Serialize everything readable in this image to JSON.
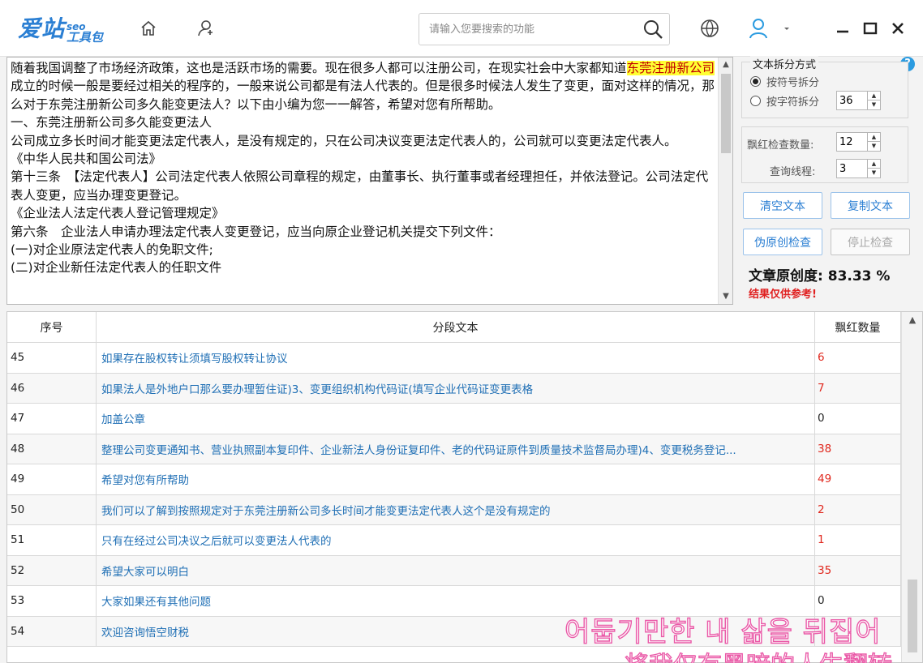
{
  "app": {
    "logo_main": "爱站",
    "logo_seo": "seo",
    "logo_tool": "工具包"
  },
  "search": {
    "placeholder": "请输入您要搜索的功能"
  },
  "editor": {
    "text_before": "随着我国调整了市场经济政策，这也是活跃市场的需要。现在很多人都可以注册公司，在现实社会中大家都知道",
    "highlight": "东莞注册新公司",
    "text_after": "成立的时候一般是要经过相关的程序的，一般来说公司都是有法人代表的。但是很多时候法人发生了变更，面对这样的情况，那么对于东莞注册新公司多久能变更法人？以下由小编为您一一解答，希望对您有所帮助。\n一、东莞注册新公司多久能变更法人\n公司成立多长时间才能变更法定代表人，是没有规定的，只在公司决议变更法定代表人的，公司就可以变更法定代表人。\n《中华人民共和国公司法》\n第十三条　【法定代表人】公司法定代表人依照公司章程的规定，由董事长、执行董事或者经理担任，并依法登记。公司法定代表人变更，应当办理变更登记。\n《企业法人法定代表人登记管理规定》\n第六条　企业法人申请办理法定代表人变更登记，应当向原企业登记机关提交下列文件：\n(一)对企业原法定代表人的免职文件;\n(二)对企业新任法定代表人的任职文件"
  },
  "panel": {
    "split_title": "文本拆分方式",
    "split_by_symbol": "按符号拆分",
    "split_by_chars": "按字符拆分",
    "chars_value": "36",
    "red_check_label": "飘红检查数量:",
    "red_check_value": "12",
    "threads_label": "查询线程:",
    "threads_value": "3",
    "clear_btn": "清空文本",
    "copy_btn": "复制文本",
    "check_btn": "伪原创检查",
    "stop_btn": "停止检查",
    "score_label": "文章原创度:",
    "score_value": "83.33 %",
    "note": "结果仅供参考!"
  },
  "table": {
    "headers": [
      "序号",
      "分段文本",
      "飘红数量"
    ],
    "rows": [
      {
        "no": "45",
        "text": "如果存在股权转让须填写股权转让协议",
        "count": "6",
        "red": true
      },
      {
        "no": "46",
        "text": "如果法人是外地户口那么要办理暂住证)3、变更组织机构代码证(填写企业代码证变更表格",
        "count": "7",
        "red": true
      },
      {
        "no": "47",
        "text": "加盖公章",
        "count": "0",
        "red": false
      },
      {
        "no": "48",
        "text": "整理公司变更通知书、营业执照副本复印件、企业新法人身份证复印件、老的代码证原件到质量技术监督局办理)4、变更税务登记...",
        "count": "38",
        "red": true
      },
      {
        "no": "49",
        "text": "希望对您有所帮助",
        "count": "49",
        "red": true
      },
      {
        "no": "50",
        "text": "我们可以了解到按照规定对于东莞注册新公司多长时间才能变更法定代表人这个是没有规定的",
        "count": "2",
        "red": true
      },
      {
        "no": "51",
        "text": "只有在经过公司决议之后就可以变更法人代表的",
        "count": "1",
        "red": true
      },
      {
        "no": "52",
        "text": "希望大家可以明白",
        "count": "35",
        "red": true
      },
      {
        "no": "53",
        "text": "大家如果还有其他问题",
        "count": "0",
        "red": false
      },
      {
        "no": "54",
        "text": "欢迎咨询悟空财税",
        "count": "",
        "red": false
      }
    ]
  },
  "overlay": {
    "line1": "어둡기만한 내 삶을 뒤집어",
    "line2": "将我仅有黑暗的人生翻转"
  },
  "colors": {
    "accent": "#2b7fd3",
    "red": "#e0281e",
    "highlight": "#ffff33",
    "overlay_stroke": "#ea5aa8"
  }
}
